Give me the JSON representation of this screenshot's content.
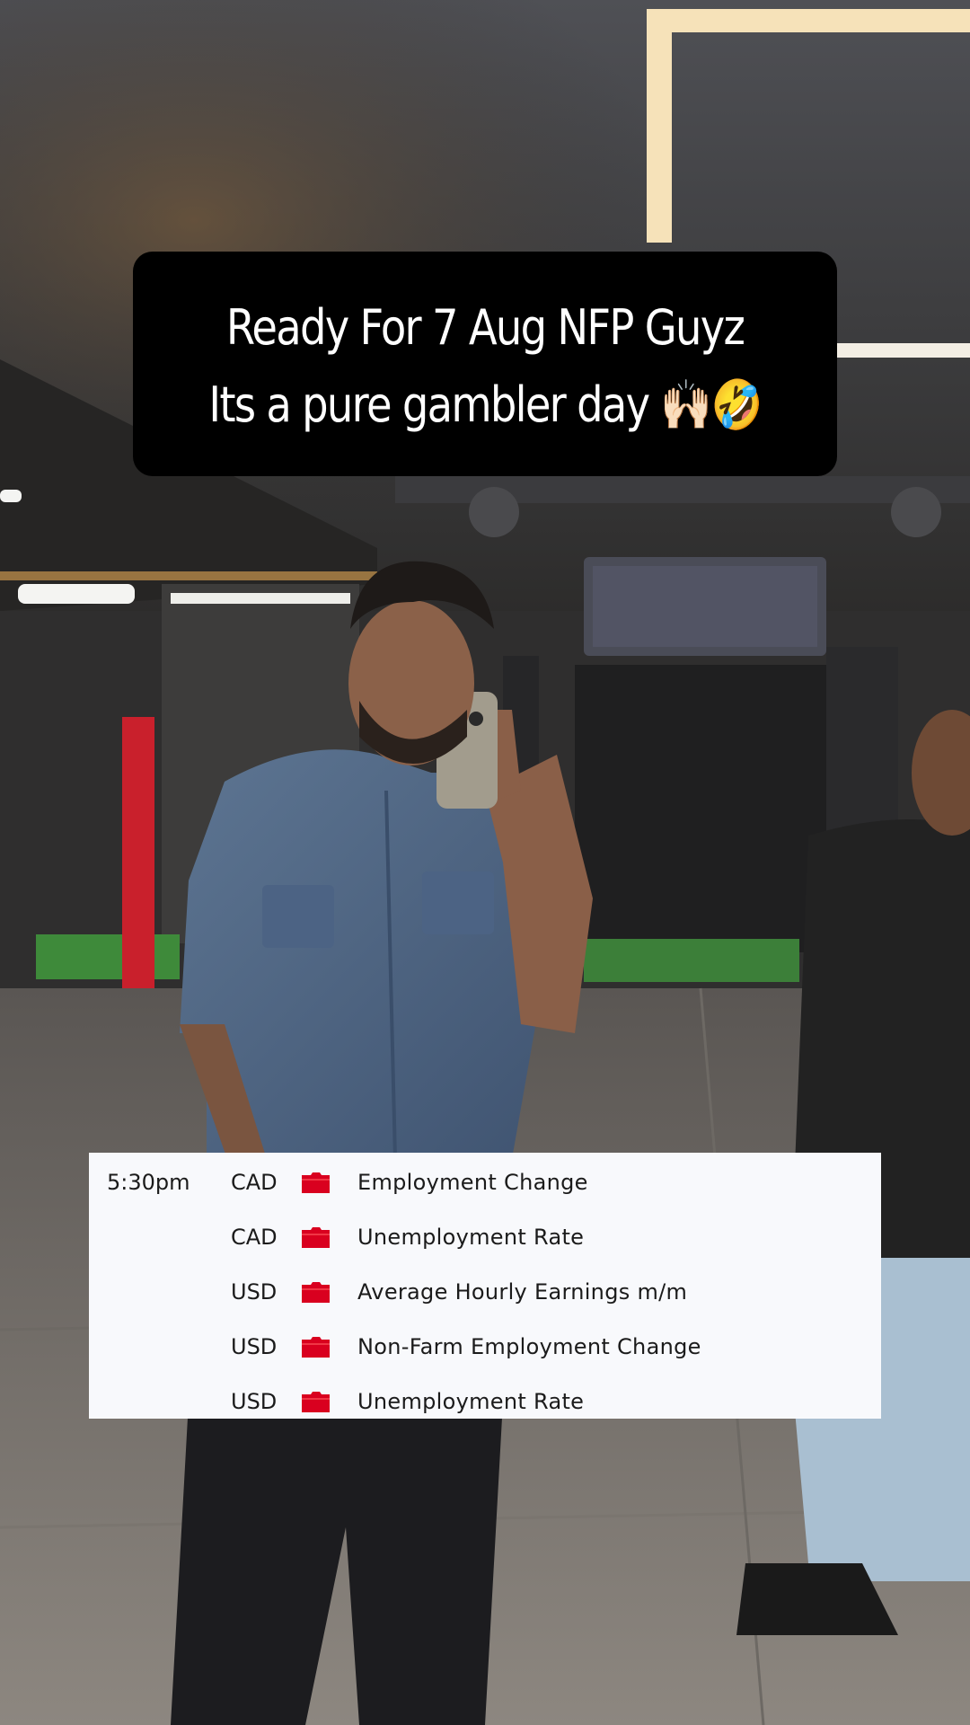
{
  "caption": {
    "line1": "Ready For 7 Aug NFP Guyz",
    "line2": "Its a pure gambler day 🙌🏻🤣"
  },
  "calendar": {
    "rows": [
      {
        "time": "5:30pm",
        "currency": "CAD",
        "impact": "high",
        "event": "Employment Change"
      },
      {
        "time": "",
        "currency": "CAD",
        "impact": "high",
        "event": "Unemployment Rate"
      },
      {
        "time": "",
        "currency": "USD",
        "impact": "high",
        "event": "Average Hourly Earnings m/m"
      },
      {
        "time": "",
        "currency": "USD",
        "impact": "high",
        "event": "Non-Farm Employment Change"
      },
      {
        "time": "",
        "currency": "USD",
        "impact": "high",
        "event": "Unemployment Rate"
      }
    ],
    "impact_color": "#d9001f"
  }
}
